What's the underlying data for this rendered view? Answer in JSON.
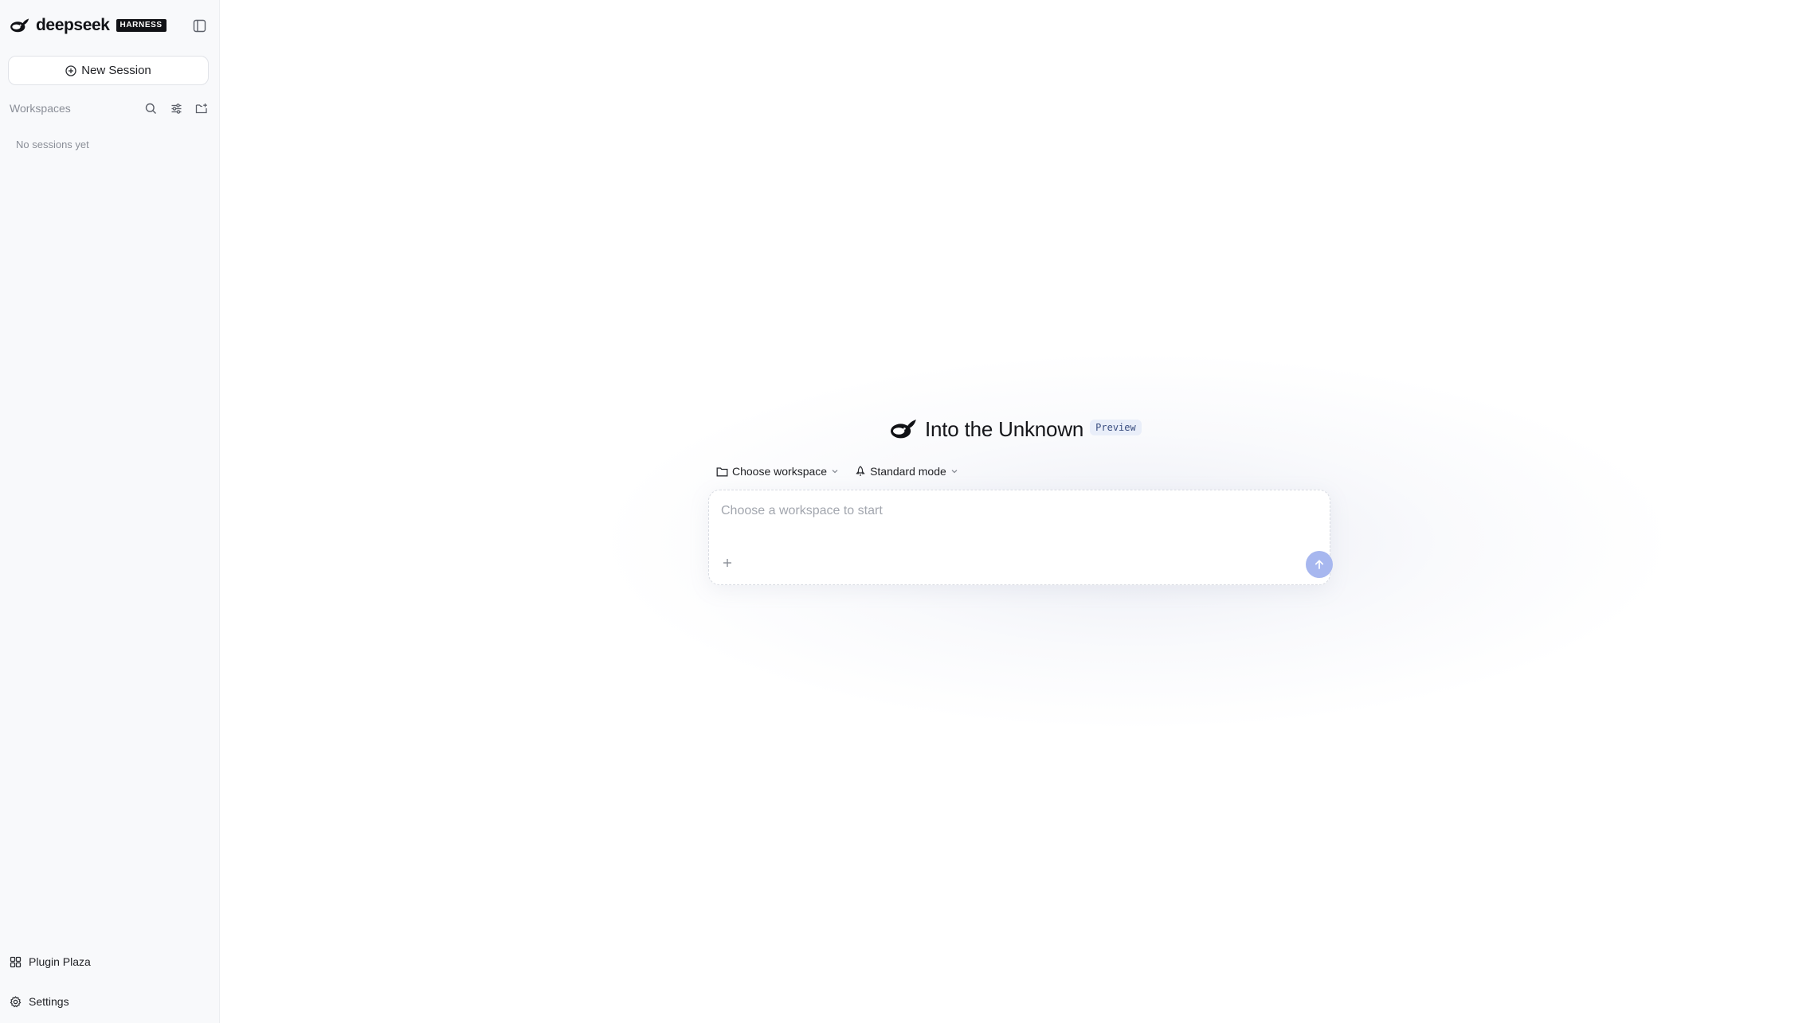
{
  "sidebar": {
    "brand": {
      "name": "deepseek",
      "badge": "HARNESS"
    },
    "new_session_label": "New Session",
    "workspaces_title": "Workspaces",
    "empty_text": "No sessions yet",
    "bottom": {
      "plugin_plaza": "Plugin Plaza",
      "settings": "Settings"
    }
  },
  "main": {
    "hero_title": "Into the Unknown",
    "hero_badge": "Preview",
    "workspace_selector": "Choose workspace",
    "mode_selector": "Standard mode",
    "composer": {
      "placeholder": "Choose a workspace to start"
    }
  },
  "icons": {
    "logo": "whale-icon",
    "collapse": "sidebar-toggle-icon",
    "new_session": "plus-circle-icon",
    "search": "search-icon",
    "filter": "sliders-icon",
    "new_folder": "folder-plus-icon",
    "plugins": "grid-icon",
    "settings": "gear-icon",
    "workspace": "folder-icon",
    "mode": "rocket-icon",
    "dropdown": "chevron-down-icon",
    "attach": "plus-icon",
    "send": "arrow-up-icon"
  },
  "colors": {
    "sidebar_bg": "#f8f9fb",
    "accent_send": "#a7b7ef",
    "badge_bg": "#e9eef9",
    "brand_badge_bg": "#111216"
  }
}
